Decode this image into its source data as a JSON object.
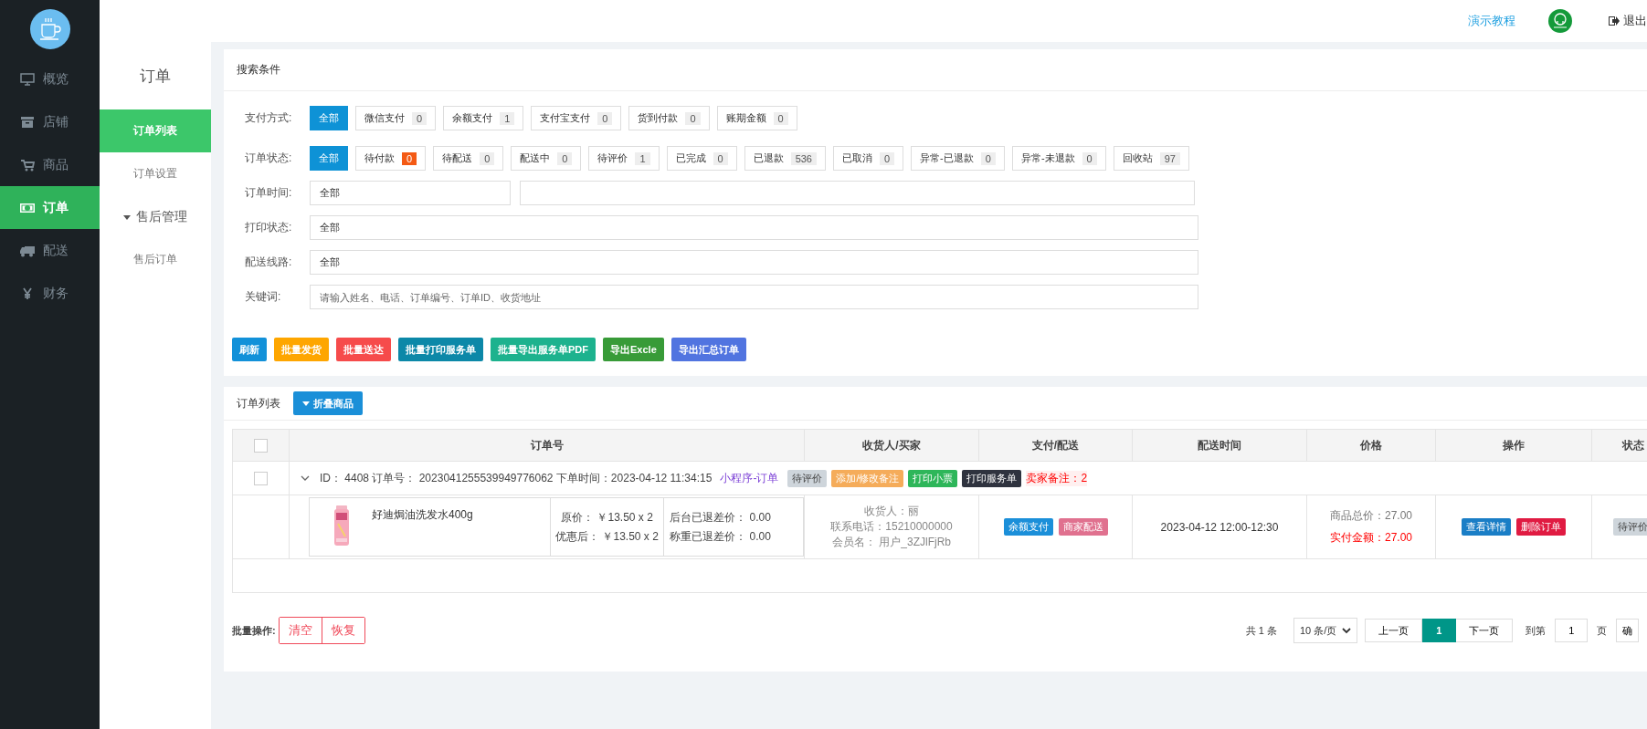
{
  "nav": {
    "items": [
      {
        "label": "概览",
        "selected": false
      },
      {
        "label": "店铺",
        "selected": false
      },
      {
        "label": "商品",
        "selected": false
      },
      {
        "label": "订单",
        "selected": true
      },
      {
        "label": "配送",
        "selected": false
      },
      {
        "label": "财务",
        "selected": false
      }
    ]
  },
  "topbar": {
    "tutorial": "演示教程",
    "logout": "退出"
  },
  "subnav": {
    "title": "订单",
    "items": [
      {
        "label": "订单列表",
        "selected": true
      },
      {
        "label": "订单设置",
        "selected": false
      },
      {
        "label": "售后管理",
        "selected": false,
        "expanded": true,
        "children": [
          {
            "label": "售后订单",
            "selected": false
          }
        ]
      }
    ]
  },
  "search": {
    "title": "搜索条件",
    "filters": [
      {
        "label": "支付方式:",
        "options": [
          {
            "label": "全部",
            "selected": true
          },
          {
            "label": "微信支付",
            "count": "0",
            "selected": false,
            "alert": false
          },
          {
            "label": "余额支付",
            "count": "1",
            "selected": false,
            "alert": false
          },
          {
            "label": "支付宝支付",
            "count": "0",
            "selected": false,
            "alert": false
          },
          {
            "label": "货到付款",
            "count": "0",
            "selected": false,
            "alert": false
          },
          {
            "label": "账期金额",
            "count": "0",
            "selected": false,
            "alert": false
          }
        ]
      },
      {
        "label": "订单状态:",
        "options": [
          {
            "label": "全部",
            "selected": true
          },
          {
            "label": "待付款",
            "count": "0",
            "selected": false,
            "alert": true
          },
          {
            "label": "待配送",
            "count": "0",
            "selected": false,
            "alert": false
          },
          {
            "label": "配送中",
            "count": "0",
            "selected": false,
            "alert": false
          },
          {
            "label": "待评价",
            "count": "1",
            "selected": false,
            "alert": false
          },
          {
            "label": "已完成",
            "count": "0",
            "selected": false,
            "alert": false
          },
          {
            "label": "已退款",
            "count": "536",
            "selected": false,
            "alert": false
          },
          {
            "label": "已取消",
            "count": "0",
            "selected": false,
            "alert": false
          },
          {
            "label": "异常-已退款",
            "count": "0",
            "selected": false,
            "alert": false
          },
          {
            "label": "异常-未退款",
            "count": "0",
            "selected": false,
            "alert": false
          },
          {
            "label": "回收站",
            "count": "97",
            "selected": false,
            "alert": false
          }
        ]
      }
    ],
    "fields": [
      {
        "label": "订单时间:",
        "kind": "range",
        "value": "全部"
      },
      {
        "label": "打印状态:",
        "kind": "select",
        "value": "全部"
      },
      {
        "label": "配送线路:",
        "kind": "select",
        "value": "全部"
      },
      {
        "label": "关键词:",
        "kind": "text",
        "placeholder": "请输入姓名、电话、订单编号、订单ID、收货地址"
      }
    ],
    "actions": [
      {
        "label": "刷新",
        "color": "#1291d9"
      },
      {
        "label": "批量发货",
        "color": "#fea600"
      },
      {
        "label": "批量送达",
        "color": "#f64b4b"
      },
      {
        "label": "批量打印服务单",
        "color": "#0c88a8"
      },
      {
        "label": "批量导出服务单PDF",
        "color": "#1db28e"
      },
      {
        "label": "导出Excle",
        "color": "#389b38"
      },
      {
        "label": "导出汇总订单",
        "color": "#5174e0"
      }
    ]
  },
  "orders": {
    "title": "订单列表",
    "fold_button": "折叠商品",
    "columns": [
      "订单号",
      "收货人/买家",
      "支付/配送",
      "配送时间",
      "价格",
      "操作",
      "状态"
    ],
    "select_all_checked": false,
    "rows": [
      {
        "checked": false,
        "expanded": true,
        "info": "ID： 4408 订单号： 2023041255539949776062 下单时间：2023-04-12 11:34:15",
        "source": "小程序-订单",
        "tags": [
          {
            "label": "待评价",
            "color": "#ced5db"
          },
          {
            "label": "添加/修改备注",
            "color": "#f5ac5a"
          },
          {
            "label": "打印小票",
            "color": "#2eb65a"
          },
          {
            "label": "打印服务单",
            "color": "#2f333f"
          }
        ],
        "seller_note": "卖家备注：2",
        "product": {
          "name": "好迪焗油洗发水400g",
          "price_lines": [
            "原价： ￥13.50 x 2",
            "优惠后： ￥13.50 x 2"
          ],
          "refund_lines": [
            "后台已退差价： 0.00",
            "称重已退差价： 0.00"
          ]
        },
        "consignee": [
          "收货人：丽",
          "联系电话：15210000000",
          "会员名： 用户_3ZJlFjRb"
        ],
        "payment_tags": [
          {
            "label": "余额支付",
            "color": "#1b8fd9"
          },
          {
            "label": "商家配送",
            "color": "#e0718f"
          }
        ],
        "delivery_time": "2023-04-12 12:00-12:30",
        "goods_total": "商品总价：27.00",
        "paid": "实付金额：27.00",
        "actions": [
          {
            "label": "查看详情",
            "color": "#1a7ec6"
          },
          {
            "label": "删除订单",
            "color": "#e01b42"
          }
        ],
        "status": "待评价"
      }
    ]
  },
  "footer": {
    "batch_label": "批量操作:",
    "batch_buttons": [
      "清空",
      "恢复"
    ],
    "total": "共 1 条",
    "page_size": "10 条/页",
    "prev": "上一页",
    "pages": [
      {
        "label": "1",
        "selected": true
      }
    ],
    "next": "下一页",
    "goto": "到第",
    "goto_value": "1",
    "page_unit": "页",
    "confirm": "确"
  }
}
